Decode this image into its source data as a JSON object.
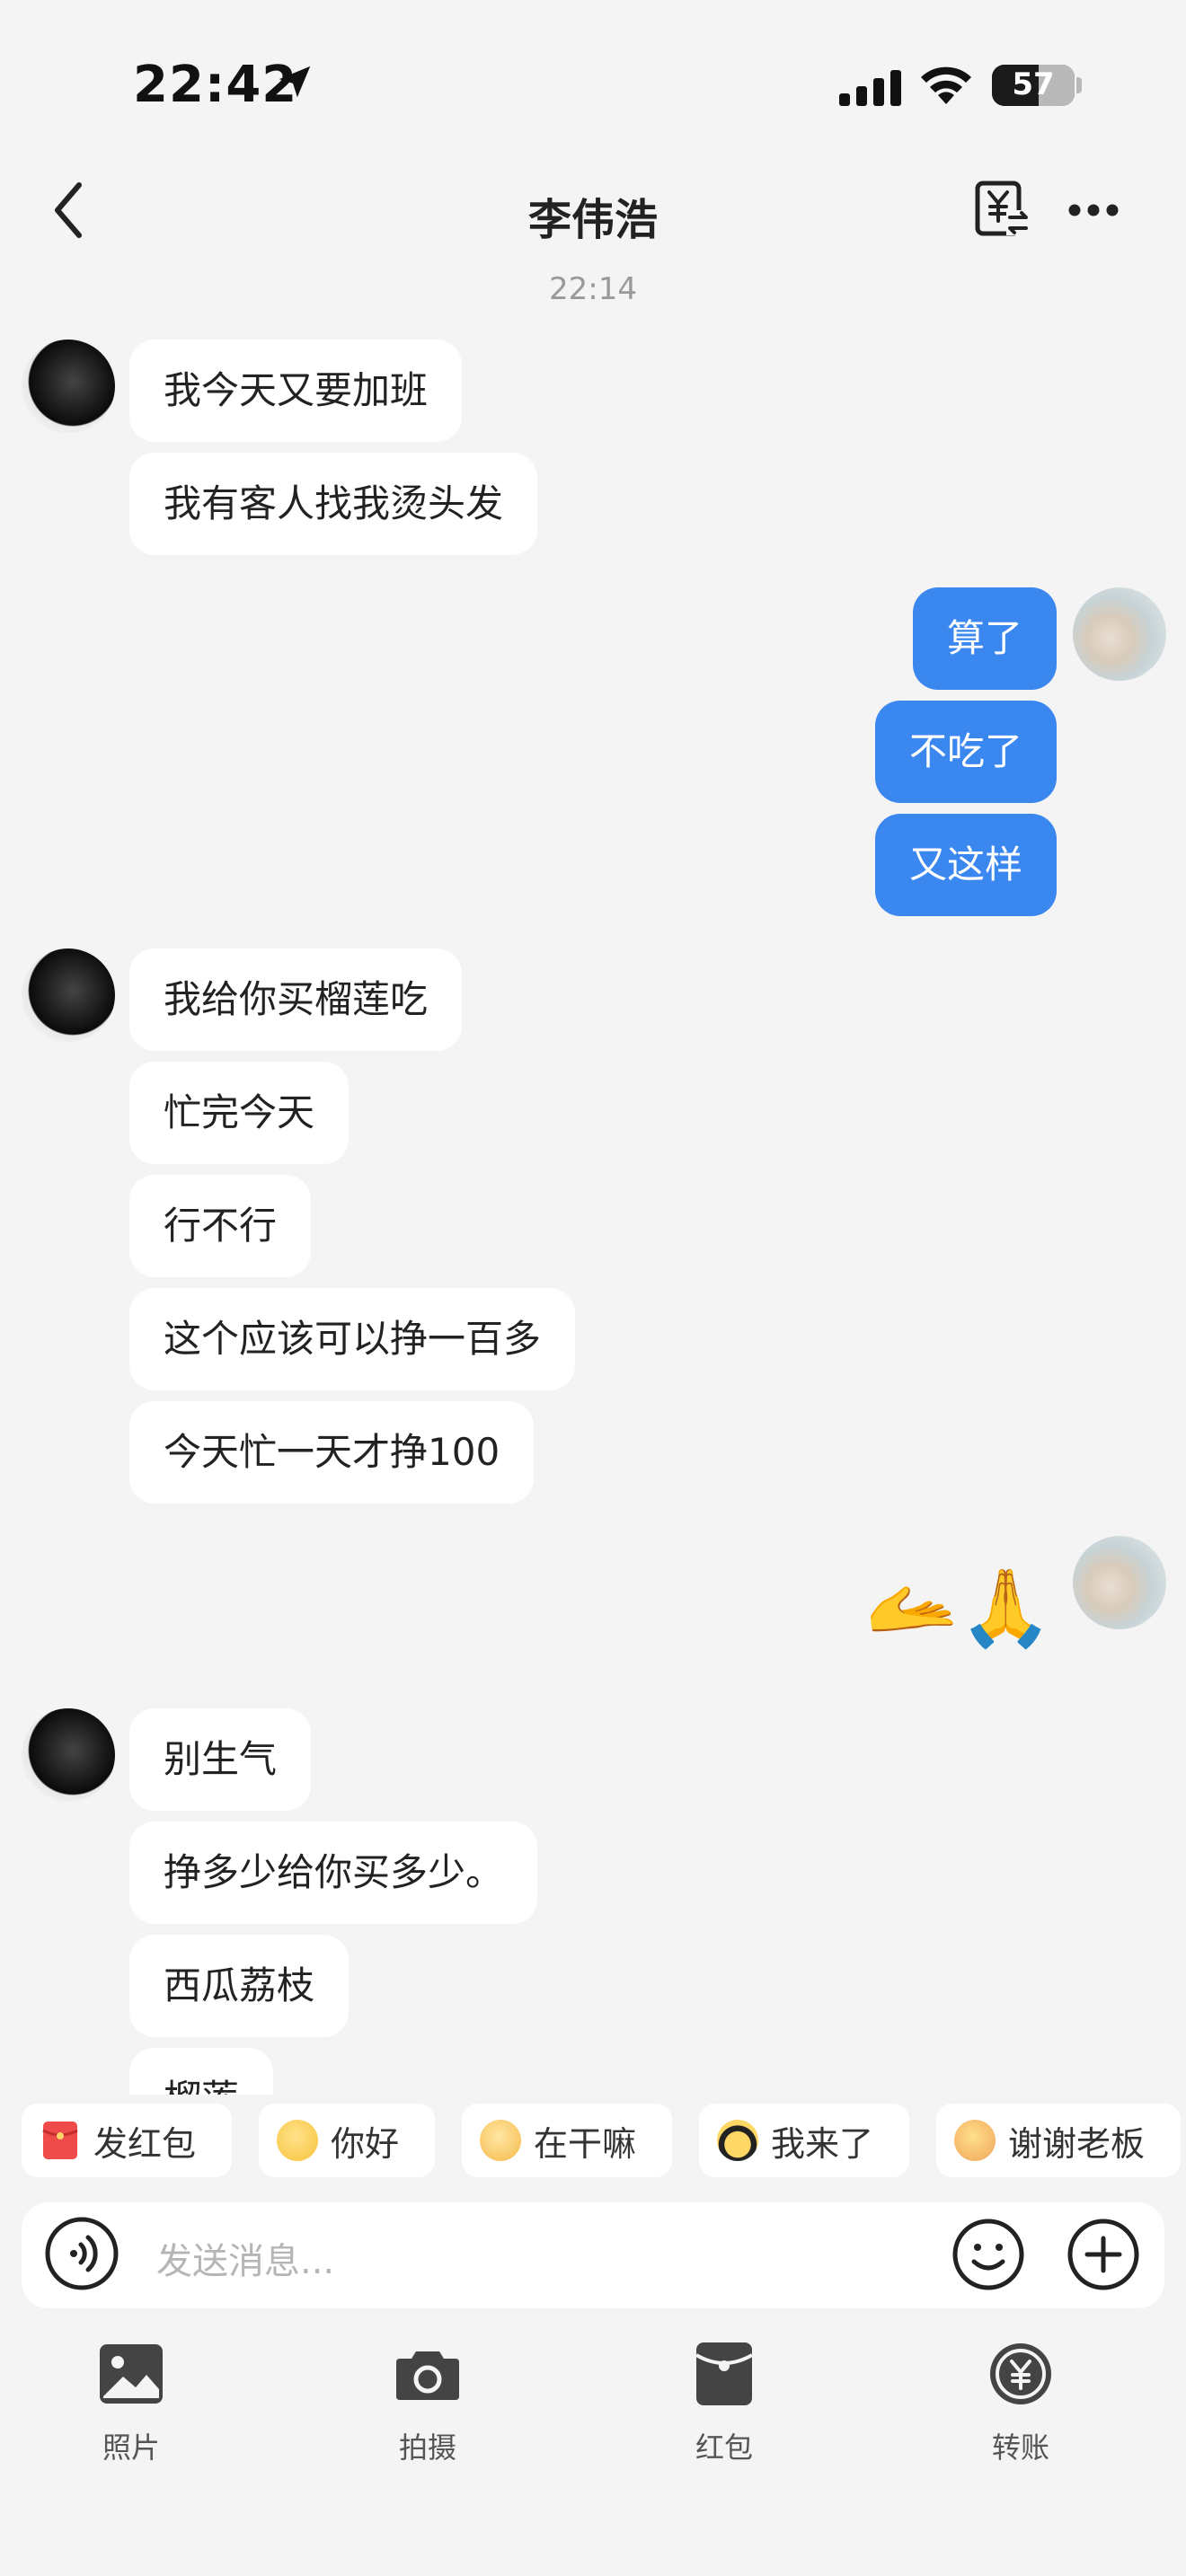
{
  "status_bar": {
    "time": "22:42",
    "battery": "57"
  },
  "header": {
    "title": "李伟浩"
  },
  "chat": {
    "timestamp": "22:14",
    "messages": [
      "我今天又要加班",
      "我有客人找我烫头发",
      "算了",
      "不吃了",
      "又这样",
      "我给你买榴莲吃",
      "忙完今天",
      "行不行",
      "这个应该可以挣一百多",
      "今天忙一天才挣100",
      "🫴🙏",
      "别生气",
      "挣多少给你买多少。",
      "西瓜荔枝",
      "榴莲"
    ]
  },
  "quick_replies": [
    {
      "label": "发红包",
      "icon": "red-envelope-icon"
    },
    {
      "label": "你好",
      "icon": "hello-emoji-icon"
    },
    {
      "label": "在干嘛",
      "icon": "what-doing-emoji-icon"
    },
    {
      "label": "我来了",
      "icon": "sunglasses-emoji-icon"
    },
    {
      "label": "谢谢老板",
      "icon": "thanks-boss-emoji-icon"
    }
  ],
  "input": {
    "placeholder": "发送消息..."
  },
  "tools": [
    {
      "label": "照片",
      "icon": "photo-icon"
    },
    {
      "label": "拍摄",
      "icon": "camera-icon"
    },
    {
      "label": "红包",
      "icon": "red-packet-icon"
    },
    {
      "label": "转账",
      "icon": "transfer-icon"
    }
  ],
  "colors": {
    "outgoing_bubble": "#3b87f0",
    "incoming_bubble": "#ffffff",
    "background": "#f4f4f4"
  }
}
